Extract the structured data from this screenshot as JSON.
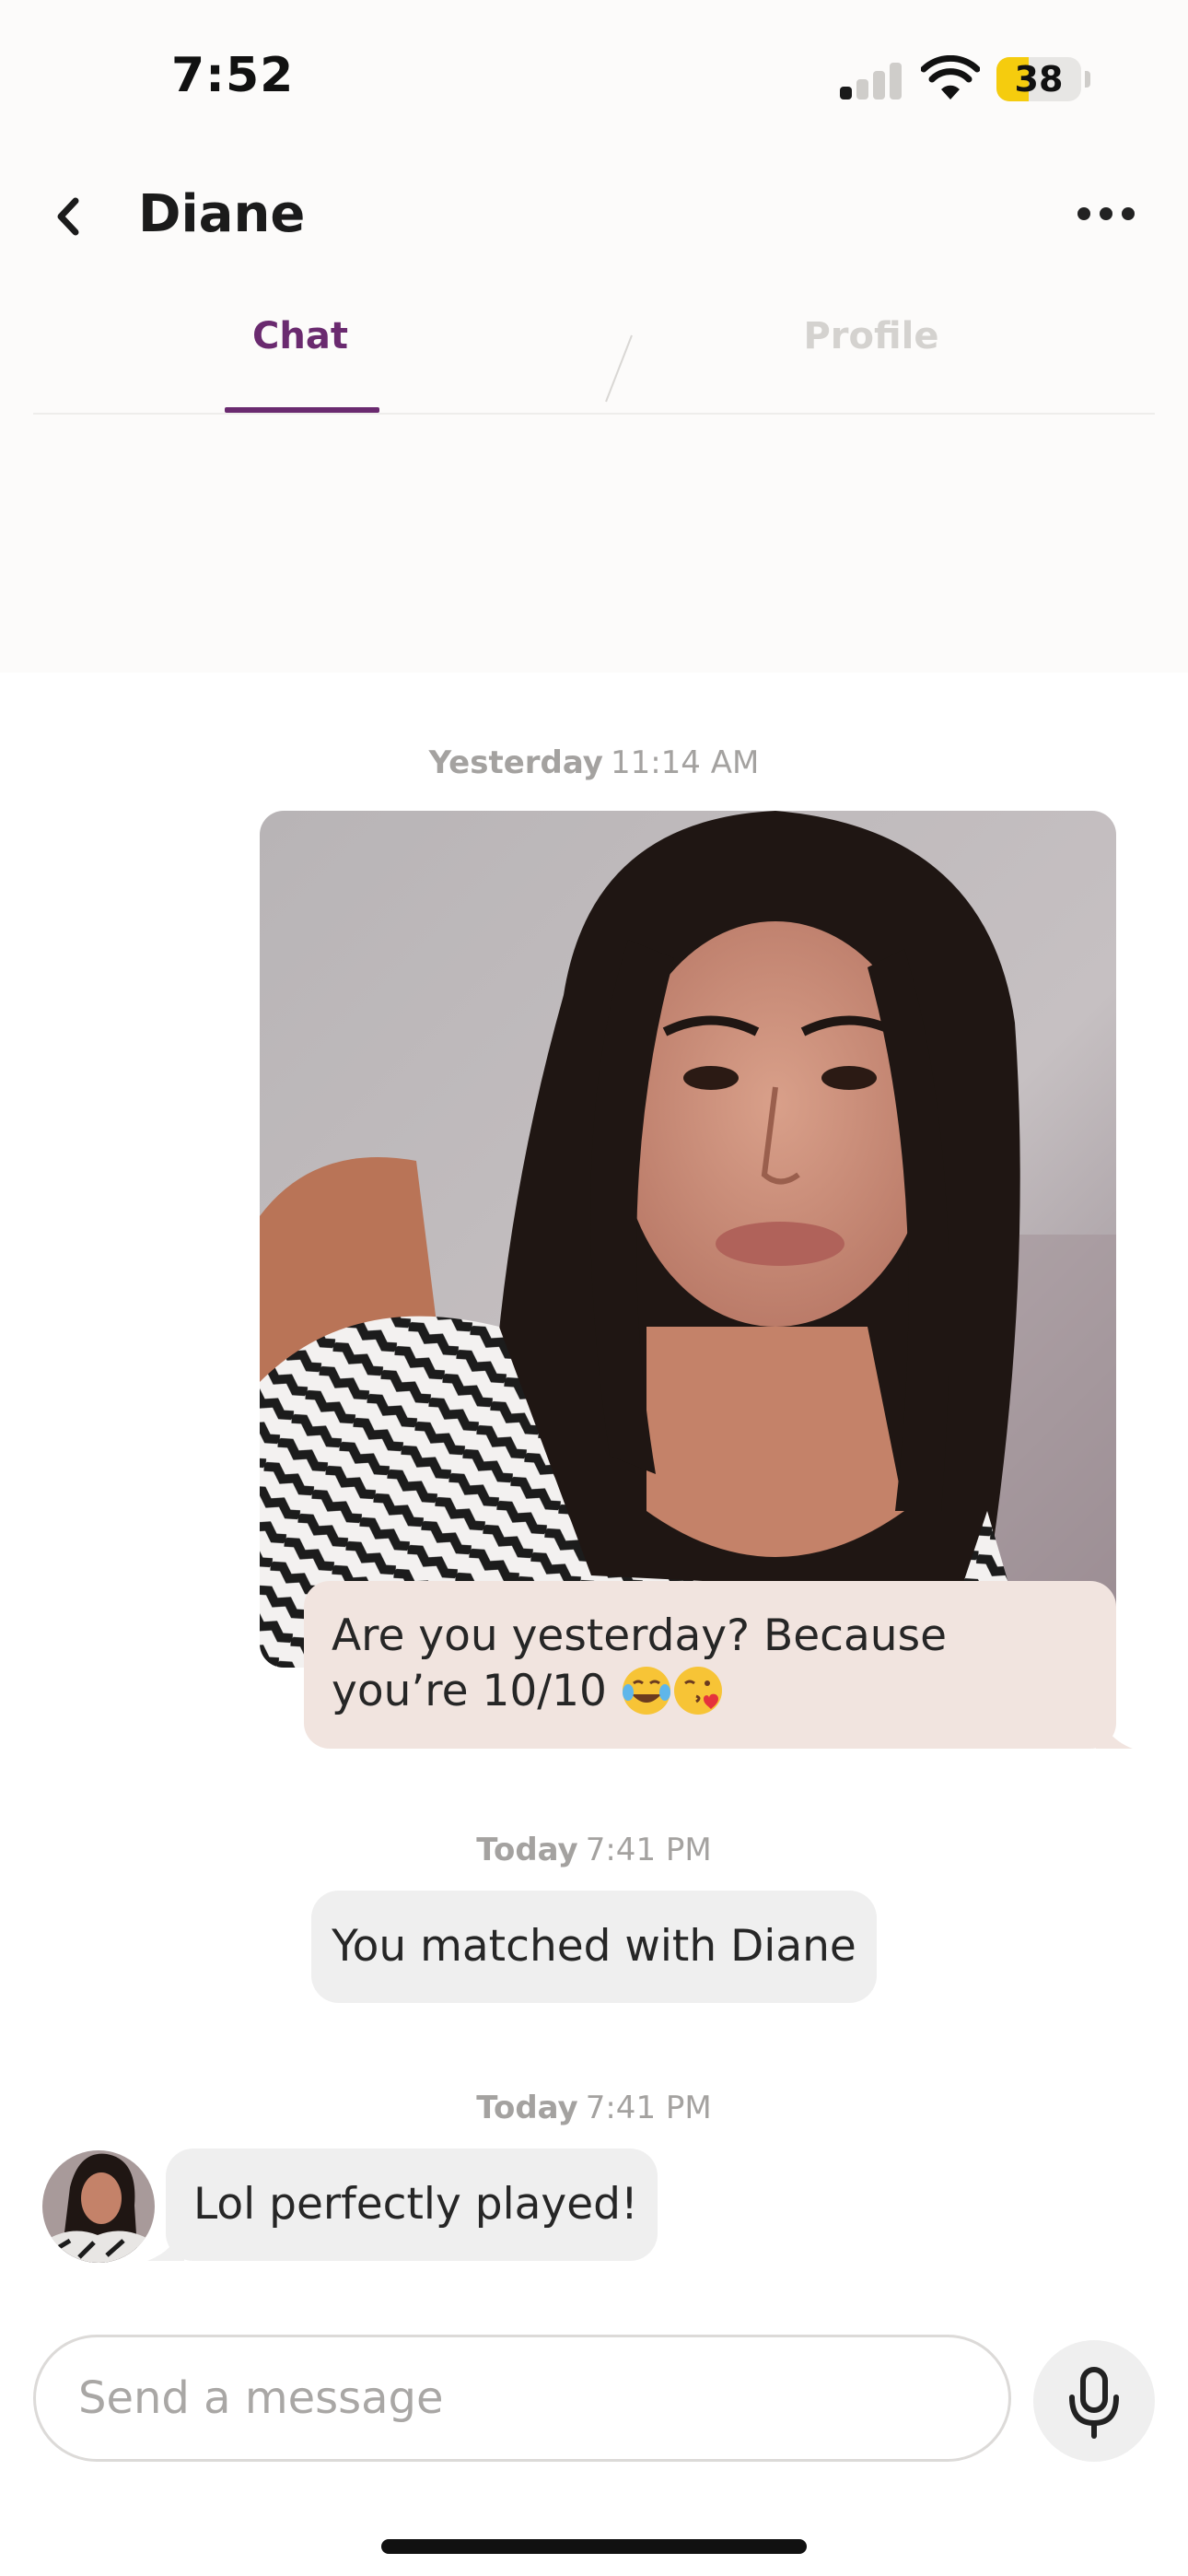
{
  "status_bar": {
    "time": "7:52",
    "battery_level": "38",
    "battery_fraction": 0.38,
    "signal_bars_active": 1,
    "signal_bars_total": 4,
    "icons": [
      "cellular-signal-icon",
      "wifi-icon",
      "battery-icon"
    ]
  },
  "header": {
    "title": "Diane",
    "back_icon": "chevron-left-icon",
    "more_icon": "more-dots-icon"
  },
  "tabs": [
    {
      "label": "Chat",
      "active": true
    },
    {
      "label": "Profile",
      "active": false
    }
  ],
  "messages": {
    "photo_timestamp": {
      "day": "Yesterday",
      "time": "11:14 AM"
    },
    "sent_text": "Are you yesterday? Because you’re 10/10",
    "sent_emojis": [
      "face-with-tears-of-joy-emoji",
      "face-blowing-a-kiss-emoji"
    ],
    "match_timestamp": {
      "day": "Today",
      "time": "7:41 PM"
    },
    "match_notice": "You matched with Diane",
    "reply_timestamp": {
      "day": "Today",
      "time": "7:41 PM"
    },
    "reply_text": "Lol perfectly played!"
  },
  "composer": {
    "placeholder": "Send a message",
    "mic_icon": "microphone-icon"
  },
  "colors": {
    "accent": "#6a2a6f",
    "sent_bubble": "#f1e4df",
    "received_bubble": "#efefef",
    "battery": "#f5cc0e",
    "timestamp": "#a4a2a0"
  }
}
